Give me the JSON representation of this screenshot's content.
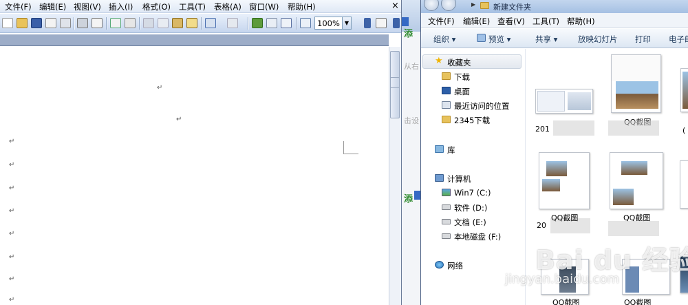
{
  "word": {
    "menus": [
      "文件(F)",
      "编辑(E)",
      "视图(V)",
      "插入(I)",
      "格式(O)",
      "工具(T)",
      "表格(A)",
      "窗口(W)",
      "帮助(H)"
    ],
    "close_glyph": "×",
    "zoom": "100%",
    "paragraph_mark": "↵"
  },
  "middle": {
    "green_label": "添",
    "gray_labels": [
      "从右",
      "击设"
    ]
  },
  "explorer": {
    "title": "新建文件夹",
    "menus": [
      "文件(F)",
      "编辑(E)",
      "查看(V)",
      "工具(T)",
      "帮助(H)"
    ],
    "commands": {
      "organize": "组织 ▾",
      "preview": "预览 ▾",
      "share": "共享 ▾",
      "slideshow": "放映幻灯片",
      "print": "打印",
      "email": "电子邮"
    },
    "nav": {
      "favorites": "收藏夹",
      "downloads": "下载",
      "desktop": "桌面",
      "recent": "最近访问的位置",
      "downloads2345": "2345下载",
      "libraries": "库",
      "computer": "计算机",
      "drive_c": "Win7 (C:)",
      "drive_d": "软件 (D:)",
      "drive_e": "文档 (E:)",
      "drive_f": "本地磁盘 (F:)",
      "network": "网络"
    },
    "files": {
      "row1": [
        "201",
        "QQ截图",
        "("
      ],
      "row2": [
        "20",
        "QQ截图",
        "QQ截图"
      ],
      "row3": [
        "QQ截图",
        "QQ截图"
      ]
    }
  },
  "watermark": {
    "brand": "Bai du 经验",
    "url": "jingyan.baidu.com"
  },
  "colors": {
    "accent": "#2e8b2e",
    "folder": "#e7c25c",
    "star": "#f0b400"
  }
}
